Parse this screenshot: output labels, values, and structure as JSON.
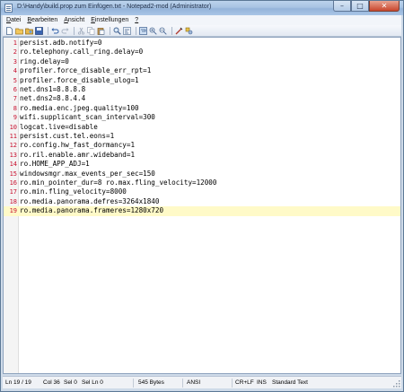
{
  "window": {
    "title": "D:\\Handy\\build.prop zum Einfügen.txt - Notepad2-mod (Administrator)",
    "min_glyph": "–",
    "max_glyph": "□",
    "close_glyph": "✕"
  },
  "menu": [
    {
      "underline": "D",
      "rest": "atei"
    },
    {
      "underline": "B",
      "rest": "earbeiten"
    },
    {
      "underline": "A",
      "rest": "nsicht"
    },
    {
      "underline": "E",
      "rest": "instellungen"
    },
    {
      "underline": "?",
      "rest": ""
    }
  ],
  "toolbar": {
    "icons": [
      "new-file-icon",
      "open-folder-icon",
      "browse-icon",
      "save-icon",
      "sep",
      "undo-icon",
      "redo-icon",
      "sep",
      "cut-icon",
      "copy-icon",
      "paste-icon",
      "sep",
      "find-icon",
      "replace-icon",
      "sep",
      "word-wrap-icon",
      "zoom-in-icon",
      "zoom-out-icon",
      "sep",
      "scheme-icon",
      "settings-icon"
    ]
  },
  "editor": {
    "current_line": 19,
    "lines": [
      {
        "n": "1",
        "text": "persist.adb.notify=0"
      },
      {
        "n": "2",
        "text": "ro.telephony.call_ring.delay=0"
      },
      {
        "n": "3",
        "text": "ring.delay=0"
      },
      {
        "n": "4",
        "text": "profiler.force_disable_err_rpt=1"
      },
      {
        "n": "5",
        "text": "profiler.force_disable_ulog=1"
      },
      {
        "n": "6",
        "text": "net.dns1=8.8.8.8"
      },
      {
        "n": "7",
        "text": "net.dns2=8.8.4.4"
      },
      {
        "n": "8",
        "text": "ro.media.enc.jpeg.quality=100"
      },
      {
        "n": "9",
        "text": "wifi.supplicant_scan_interval=300"
      },
      {
        "n": "10",
        "text": "logcat.live=disable"
      },
      {
        "n": "11",
        "text": "persist.cust.tel.eons=1"
      },
      {
        "n": "12",
        "text": "ro.config.hw_fast_dormancy=1"
      },
      {
        "n": "13",
        "text": "ro.ril.enable.amr.wideband=1"
      },
      {
        "n": "14",
        "text": "ro.HOME_APP_ADJ=1"
      },
      {
        "n": "15",
        "text": "windowsmgr.max_events_per_sec=150"
      },
      {
        "n": "16",
        "text": "ro.min_pointer_dur=8 ro.max.fling_velocity=12000"
      },
      {
        "n": "17",
        "text": "ro.min.fling_velocity=8000"
      },
      {
        "n": "18",
        "text": "ro.media.panorama.defres=3264x1840"
      },
      {
        "n": "19",
        "text": "ro.media.panorama.frameres=1280x720"
      }
    ]
  },
  "status": {
    "position": "Ln 19 / 19",
    "col": "Col 36",
    "sel": "Sel 0",
    "sel_ln": "Sel Ln 0",
    "size": "545 Bytes",
    "encoding": "ANSI",
    "eol": "CR+LF",
    "mode": "INS",
    "scheme": "Standard Text"
  }
}
